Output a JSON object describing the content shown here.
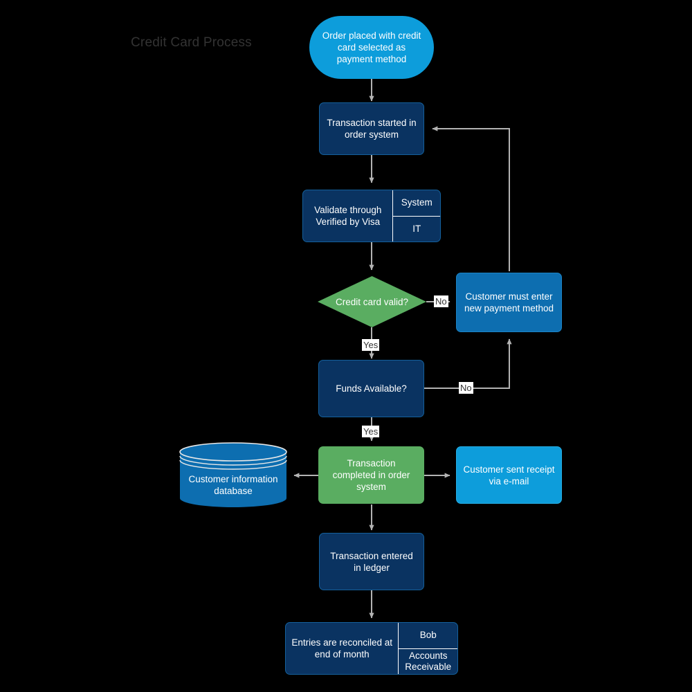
{
  "diagram": {
    "title": "Credit Card Process",
    "background_color": "#000000",
    "edge_color": "#b3b3b3",
    "palette": {
      "navy": "#0a3361",
      "blue": "#0d6eb0",
      "cyan": "#0d9ddb",
      "green": "#5aad61",
      "title_text": "#333333",
      "node_text": "#ffffff",
      "label_bg": "#ffffff",
      "label_text": "#333333"
    },
    "nodes": {
      "start": {
        "label": "Order placed with credit card selected as payment method",
        "shape": "stadium",
        "color": "#0d9ddb"
      },
      "transaction_started": {
        "label": "Transaction started in order system",
        "shape": "rounded-rect",
        "color": "#0a3361"
      },
      "validate": {
        "label": "Validate through Verified by Visa",
        "shape": "rounded-rect-split",
        "color": "#0a3361",
        "side_top": "System",
        "side_bottom": "IT"
      },
      "credit_card_valid": {
        "label": "Credit card valid?",
        "shape": "diamond",
        "color": "#5aad61"
      },
      "new_payment_method": {
        "label": "Customer must enter new payment method",
        "shape": "rounded-rect",
        "color": "#0d6eb0"
      },
      "funds_available": {
        "label": "Funds Available?",
        "shape": "rounded-rect",
        "color": "#0a3361"
      },
      "transaction_completed": {
        "label": "Transaction completed in order system",
        "shape": "rounded-rect",
        "color": "#5aad61"
      },
      "customer_database": {
        "label": "Customer information database",
        "shape": "cylinder",
        "color": "#0d6eb0"
      },
      "receipt_email": {
        "label": "Customer sent receipt via e-mail",
        "shape": "rounded-rect",
        "color": "#0d9ddb"
      },
      "ledger": {
        "label": "Transaction entered in ledger",
        "shape": "rounded-rect",
        "color": "#0a3361"
      },
      "reconcile": {
        "label": "Entries are reconciled at end of month",
        "shape": "rounded-rect-split",
        "color": "#0a3361",
        "side_top": "Bob",
        "side_bottom": "Accounts Receivable"
      }
    },
    "edge_labels": {
      "valid_no": "No",
      "valid_yes": "Yes",
      "funds_no": "No",
      "funds_yes": "Yes"
    },
    "edges": [
      {
        "from": "start",
        "to": "transaction_started",
        "label": ""
      },
      {
        "from": "transaction_started",
        "to": "validate",
        "label": ""
      },
      {
        "from": "validate",
        "to": "credit_card_valid",
        "label": ""
      },
      {
        "from": "credit_card_valid",
        "to": "new_payment_method",
        "label": "No"
      },
      {
        "from": "credit_card_valid",
        "to": "funds_available",
        "label": "Yes"
      },
      {
        "from": "new_payment_method",
        "to": "transaction_started",
        "label": ""
      },
      {
        "from": "funds_available",
        "to": "new_payment_method",
        "label": "No"
      },
      {
        "from": "funds_available",
        "to": "transaction_completed",
        "label": "Yes"
      },
      {
        "from": "transaction_completed",
        "to": "customer_database",
        "label": ""
      },
      {
        "from": "transaction_completed",
        "to": "receipt_email",
        "label": ""
      },
      {
        "from": "transaction_completed",
        "to": "ledger",
        "label": ""
      },
      {
        "from": "ledger",
        "to": "reconcile",
        "label": ""
      }
    ]
  }
}
